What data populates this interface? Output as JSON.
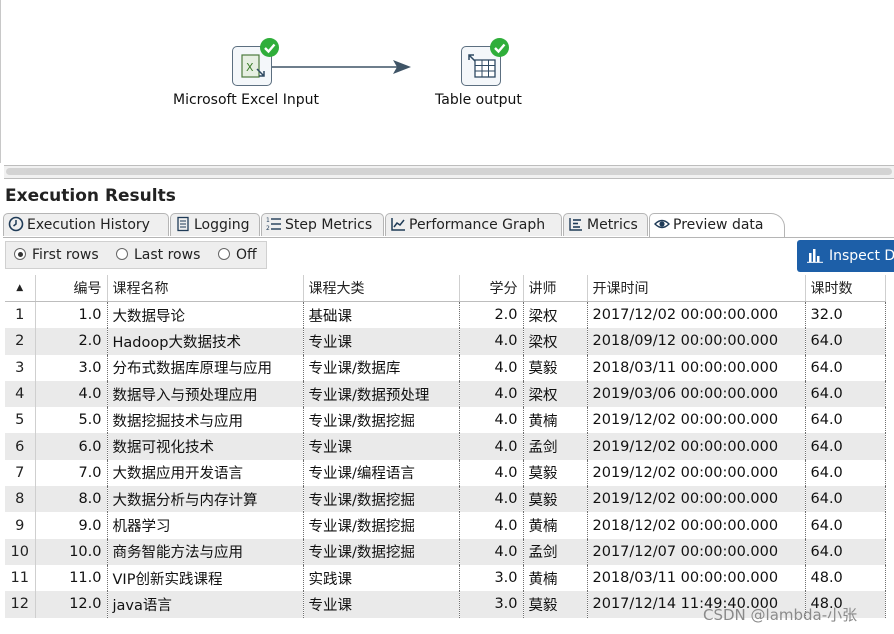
{
  "canvas": {
    "steps": [
      {
        "label": "Microsoft Excel Input",
        "icon": "excel-input-icon",
        "status": "success"
      },
      {
        "label": "Table output",
        "icon": "table-output-icon",
        "status": "success"
      }
    ]
  },
  "results": {
    "title": "Execution Results",
    "tabs": [
      {
        "label": "Execution History",
        "icon": "clock-icon"
      },
      {
        "label": "Logging",
        "icon": "document-icon"
      },
      {
        "label": "Step Metrics",
        "icon": "numbered-list-icon"
      },
      {
        "label": "Performance Graph",
        "icon": "line-chart-icon"
      },
      {
        "label": "Metrics",
        "icon": "metrics-list-icon"
      },
      {
        "label": "Preview data",
        "icon": "eye-icon",
        "active": true
      }
    ],
    "options": [
      {
        "label": "First rows",
        "selected": true
      },
      {
        "label": "Last rows",
        "selected": false
      },
      {
        "label": "Off",
        "selected": false
      }
    ],
    "inspect_button": "Inspect D",
    "sort_indicator": "▲"
  },
  "table": {
    "columns": [
      "编号",
      "课程名称",
      "课程大类",
      "学分",
      "讲师",
      "开课时间",
      "课时数"
    ],
    "rows": [
      [
        "1",
        "1.0",
        "大数据导论",
        "基础课",
        "2.0",
        "梁权",
        "2017/12/02 00:00:00.000",
        "32.0"
      ],
      [
        "2",
        "2.0",
        "Hadoop大数据技术",
        "专业课",
        "4.0",
        "梁权",
        "2018/09/12 00:00:00.000",
        "64.0"
      ],
      [
        "3",
        "3.0",
        "分布式数据库原理与应用",
        "专业课/数据库",
        "4.0",
        "莫毅",
        "2018/03/11 00:00:00.000",
        "64.0"
      ],
      [
        "4",
        "4.0",
        "数据导入与预处理应用",
        "专业课/数据预处理",
        "4.0",
        "梁权",
        "2019/03/06 00:00:00.000",
        "64.0"
      ],
      [
        "5",
        "5.0",
        "数据挖掘技术与应用",
        "专业课/数据挖掘",
        "4.0",
        "黄楠",
        "2019/12/02 00:00:00.000",
        "64.0"
      ],
      [
        "6",
        "6.0",
        "数据可视化技术",
        "专业课",
        "4.0",
        "孟剑",
        "2019/12/02 00:00:00.000",
        "64.0"
      ],
      [
        "7",
        "7.0",
        "大数据应用开发语言",
        "专业课/编程语言",
        "4.0",
        "莫毅",
        "2019/12/02 00:00:00.000",
        "64.0"
      ],
      [
        "8",
        "8.0",
        "大数据分析与内存计算",
        "专业课/数据挖掘",
        "4.0",
        "莫毅",
        "2019/12/02 00:00:00.000",
        "64.0"
      ],
      [
        "9",
        "9.0",
        "机器学习",
        "专业课/数据挖掘",
        "4.0",
        "黄楠",
        "2018/12/02 00:00:00.000",
        "64.0"
      ],
      [
        "10",
        "10.0",
        "商务智能方法与应用",
        "专业课/数据挖掘",
        "4.0",
        "孟剑",
        "2017/12/07 00:00:00.000",
        "64.0"
      ],
      [
        "11",
        "11.0",
        "VIP创新实践课程",
        "实践课",
        "3.0",
        "黄楠",
        "2018/03/11 00:00:00.000",
        "48.0"
      ],
      [
        "12",
        "12.0",
        "java语言",
        "专业课",
        "3.0",
        "莫毅",
        "2017/12/14 11:49:40.000",
        "48.0"
      ]
    ]
  },
  "watermark": "CSDN @lambda-小张",
  "colors": {
    "success": "#2fae3a",
    "inspect_button": "#1d5fa8",
    "row_alt": "#eaeaea"
  }
}
